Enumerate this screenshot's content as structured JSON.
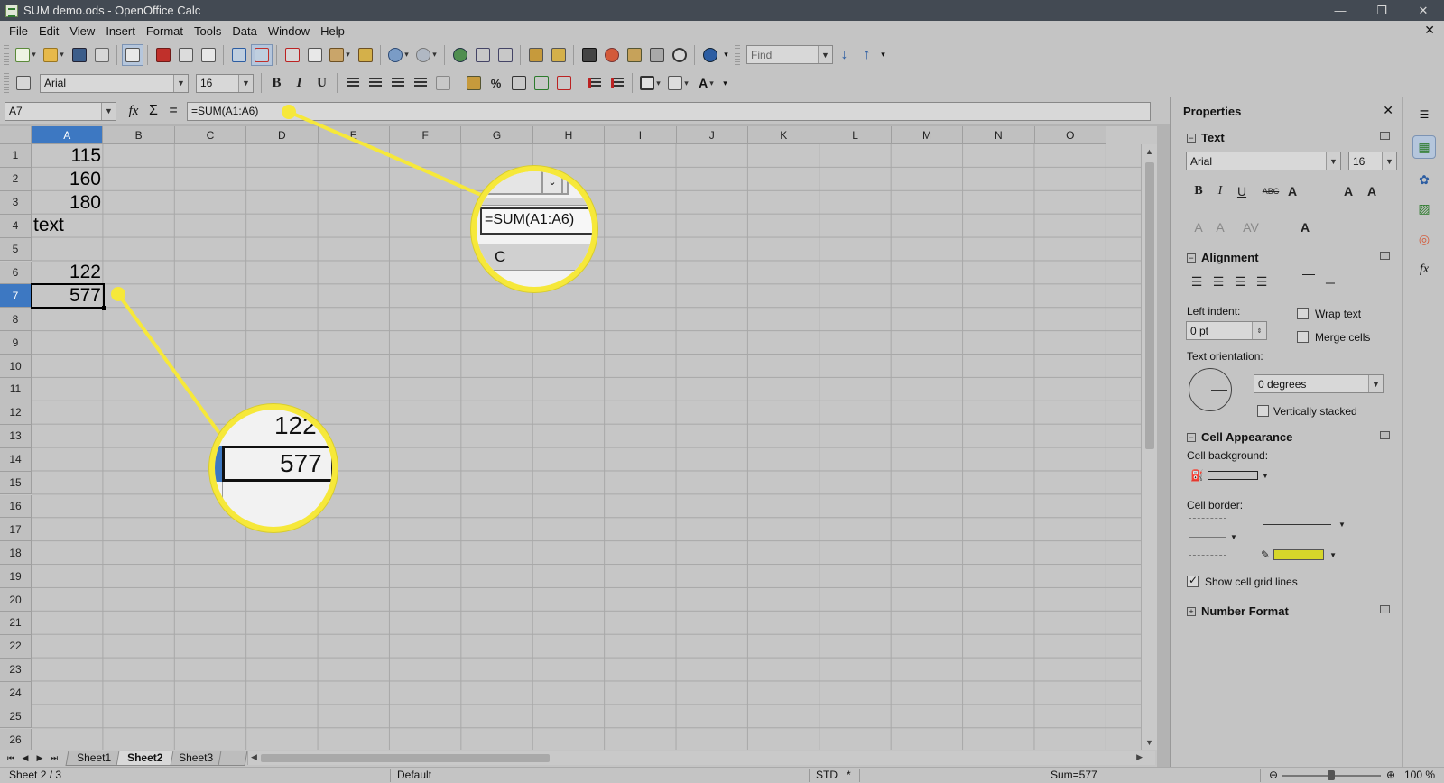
{
  "window": {
    "title": "SUM demo.ods - OpenOffice Calc",
    "controls": [
      "—",
      "❐",
      "✕"
    ]
  },
  "menu": [
    "File",
    "Edit",
    "View",
    "Insert",
    "Format",
    "Tools",
    "Data",
    "Window",
    "Help"
  ],
  "toolbar": {
    "find_placeholder": "Find",
    "font_name": "Arial",
    "font_size": "16",
    "bold": "B",
    "italic": "I",
    "underline": "U"
  },
  "formula_bar": {
    "cell_ref": "A7",
    "formula": "=SUM(A1:A6)",
    "fx": "fx",
    "sigma": "Σ",
    "equals": "="
  },
  "grid": {
    "columns": [
      "A",
      "B",
      "C",
      "D",
      "E",
      "F",
      "G",
      "H",
      "I",
      "J",
      "K",
      "L",
      "M",
      "N",
      "O"
    ],
    "rows": [
      "1",
      "2",
      "3",
      "4",
      "5",
      "6",
      "7",
      "8",
      "9",
      "10",
      "11",
      "12",
      "13",
      "14",
      "15",
      "16",
      "17",
      "18",
      "19",
      "20",
      "21",
      "22",
      "23",
      "24",
      "25",
      "26"
    ],
    "active_column": "A",
    "active_row": "7",
    "cells": {
      "a1": "115",
      "a2": "160",
      "a3": "180",
      "a4": "text",
      "a6": "122",
      "a7": "577"
    }
  },
  "sheets": {
    "tabs": [
      "Sheet1",
      "Sheet2",
      "Sheet3"
    ],
    "active": "Sheet2"
  },
  "status": {
    "sheet": "Sheet 2 / 3",
    "page_style": "Default",
    "mode": "STD",
    "modified": "*",
    "sum": "Sum=577",
    "zoom": "100 %",
    "zoom_fraction": 0.5
  },
  "sidebar": {
    "title": "Properties",
    "text_section": {
      "title": "Text",
      "font": "Arial",
      "size": "16"
    },
    "alignment_section": {
      "title": "Alignment",
      "left_indent_label": "Left indent:",
      "left_indent_value": "0 pt",
      "wrap_text": "Wrap text",
      "merge_cells": "Merge cells",
      "text_orientation_label": "Text orientation:",
      "orientation_value": "0 degrees",
      "vertically_stacked": "Vertically stacked"
    },
    "cell_appearance_section": {
      "title": "Cell Appearance",
      "background_label": "Cell background:",
      "border_label": "Cell border:",
      "show_grid": "Show cell grid lines"
    },
    "number_format_section": {
      "title": "Number Format"
    }
  },
  "callouts": {
    "formula_zoom": {
      "ref_fragment": "",
      "formula": "=SUM(A1:A6)",
      "col": "C"
    },
    "cell_zoom": {
      "above": "122",
      "value": "577"
    }
  },
  "colors": {
    "highlight": "#f6e83a",
    "active_header": "#3d78c2",
    "border_color_swatch": "#d6d62a"
  }
}
